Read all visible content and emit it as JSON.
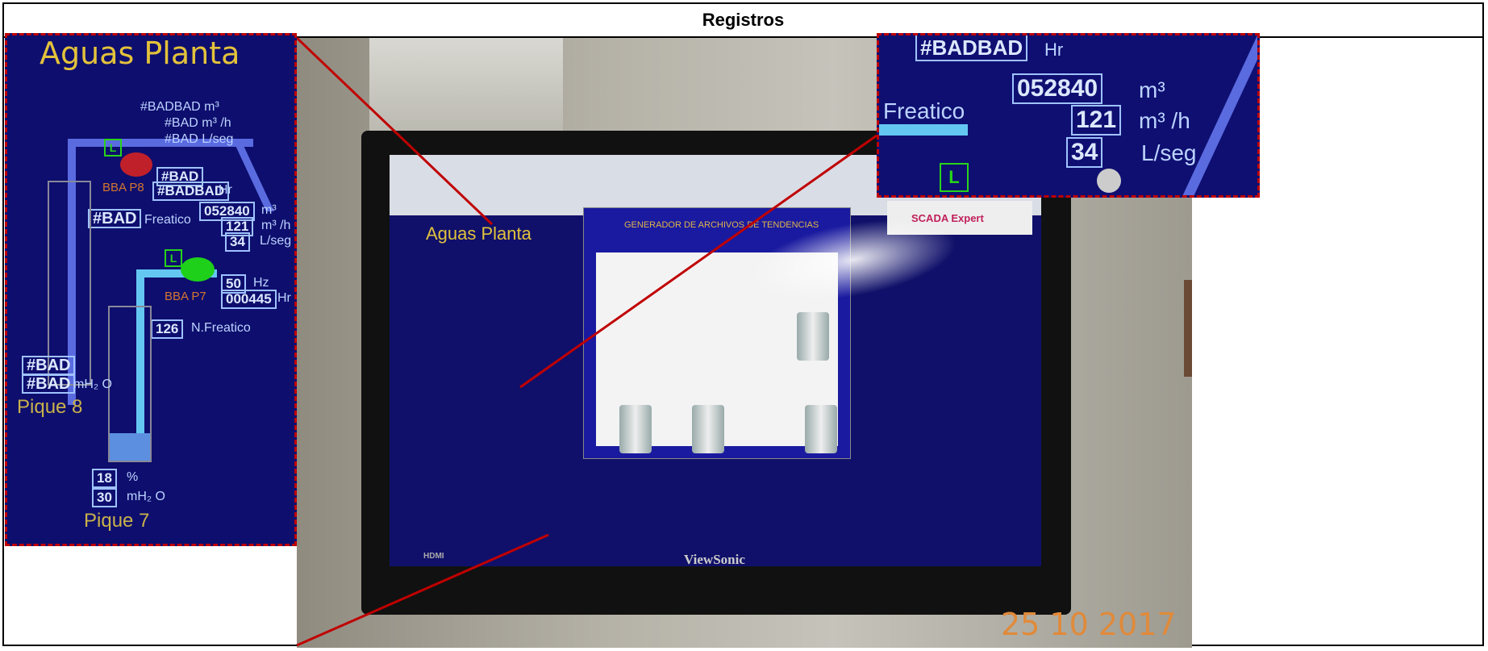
{
  "header": {
    "title": "Registros"
  },
  "photo": {
    "monitor_brand": "ViewSonic",
    "port_label": "HDMI",
    "date_stamp": "25 10 2017",
    "screen_title": "Aguas Planta",
    "dialog_title": "GENERADOR DE ARCHIVOS DE TENDENCIAS",
    "scada_brand": "SCADA Expert"
  },
  "zoom_left": {
    "title": "Aguas Planta",
    "top_readings": [
      "#BADBAD m³",
      "#BAD m³ /h",
      "#BAD L/seg"
    ],
    "pump_p8": "BBA P8",
    "p8_value": "#BAD",
    "p8_hours": "#BADBAD",
    "p8_hours_unit": "Hr",
    "freatico_code": "#BAD",
    "freatico_label": "Freatico",
    "volume": "052840",
    "volume_unit": "m³",
    "flow": "121",
    "flow_unit": "m³ /h",
    "rate": "34",
    "rate_unit": "L/seg",
    "hz_value": "50",
    "hz_unit": "Hz",
    "pump_p7": "BBA P7",
    "p7_hours": "000445",
    "p7_hours_unit": "Hr",
    "nf_value": "126",
    "nf_label": "N.Freatico",
    "p8_level_a": "#BAD",
    "p8_level_b": "#BAD",
    "p8_level_b_unit": "mH₂ O",
    "pique8": "Pique 8",
    "p7_percent": "18",
    "percent_unit": "%",
    "p7_mh2o": "30",
    "mh2o_unit": "mH₂ O",
    "pique7": "Pique 7",
    "l_badge": "L"
  },
  "zoom_right": {
    "top_text": "#BADBAD",
    "top_unit": "Hr",
    "volume": "052840",
    "volume_unit": "m³",
    "freatico_label": "Freatico",
    "flow": "121",
    "flow_unit": "m³ /h",
    "rate": "34",
    "rate_unit": "L/seg",
    "l_badge": "L"
  },
  "colors": {
    "highlight": "#c00000",
    "hmi_bg": "#0e0e6e",
    "accent_gold": "#e3c23b"
  }
}
